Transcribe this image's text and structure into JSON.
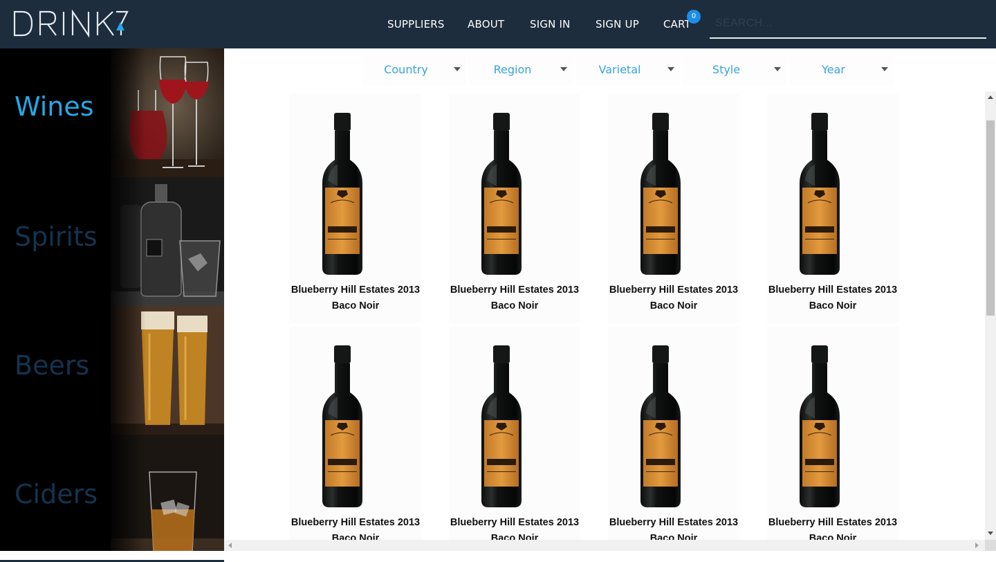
{
  "brand": {
    "name": "DRINKY"
  },
  "nav": {
    "suppliers": "SUPPLIERS",
    "about": "ABOUT",
    "sign_in": "SIGN IN",
    "sign_up": "SIGN UP",
    "cart": "CART",
    "cart_count": "0"
  },
  "search": {
    "placeholder": "SEARCH..."
  },
  "sidebar": {
    "items": [
      {
        "label": "Wines",
        "active": true
      },
      {
        "label": "Spirits"
      },
      {
        "label": "Beers"
      },
      {
        "label": "Ciders"
      }
    ]
  },
  "filters": [
    "Country",
    "Region",
    "Varietal",
    "Style",
    "Year"
  ],
  "products": [
    {
      "line1": "Blueberry Hill Estates 2013",
      "line2": "Baco Noir"
    },
    {
      "line1": "Blueberry Hill Estates 2013",
      "line2": "Baco Noir"
    },
    {
      "line1": "Blueberry Hill Estates 2013",
      "line2": "Baco Noir"
    },
    {
      "line1": "Blueberry Hill Estates 2013",
      "line2": "Baco Noir"
    },
    {
      "line1": "Blueberry Hill Estates 2013",
      "line2": "Baco Noir"
    },
    {
      "line1": "Blueberry Hill Estates 2013",
      "line2": "Baco Noir"
    },
    {
      "line1": "Blueberry Hill Estates 2013",
      "line2": "Baco Noir"
    },
    {
      "line1": "Blueberry Hill Estates 2013",
      "line2": "Baco Noir"
    }
  ],
  "colors": {
    "header": "#1d2d3e",
    "accent": "#24a8e6",
    "badge": "#1d8ee8"
  }
}
